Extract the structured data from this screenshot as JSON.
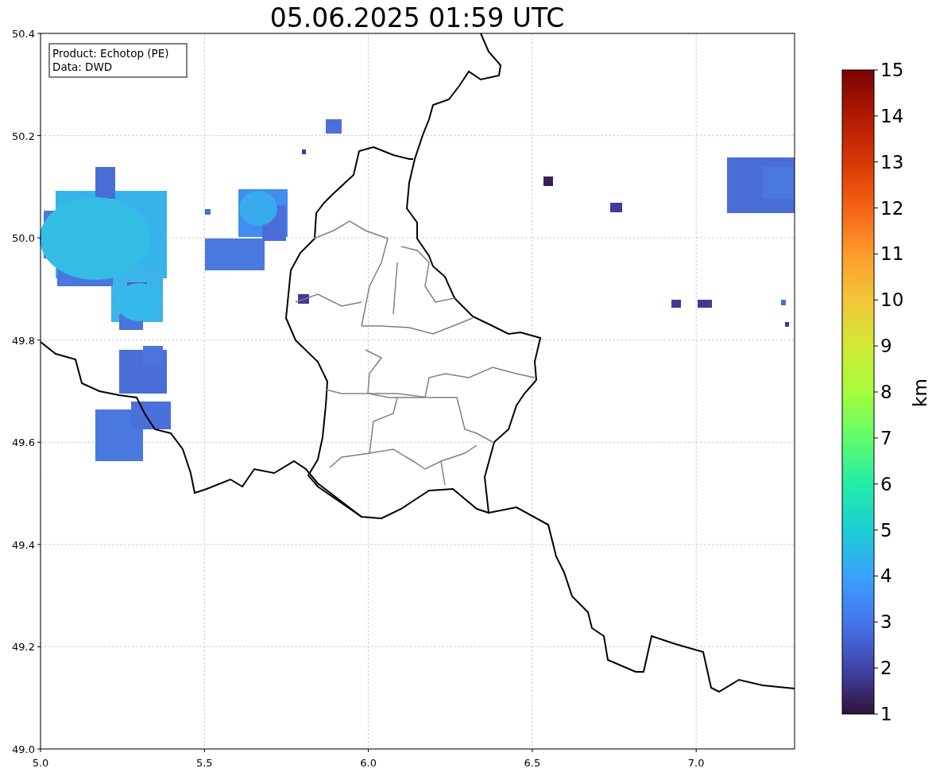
{
  "title": "05.06.2025 01:59 UTC",
  "info_box": [
    "Product: Echotop (PE)",
    "Data: DWD"
  ],
  "map": {
    "x_ticks": [
      "5.0",
      "5.5",
      "6.0",
      "6.5",
      "7.0"
    ],
    "y_ticks": [
      "50.4",
      "50.2",
      "50.0",
      "49.8",
      "49.6",
      "49.4",
      "49.2",
      "49.0"
    ]
  },
  "colorbar": {
    "label": "km",
    "ticks": [
      "15",
      "14",
      "13",
      "12",
      "11",
      "10",
      "9",
      "8",
      "7",
      "6",
      "5",
      "4",
      "3",
      "2",
      "1"
    ]
  }
}
